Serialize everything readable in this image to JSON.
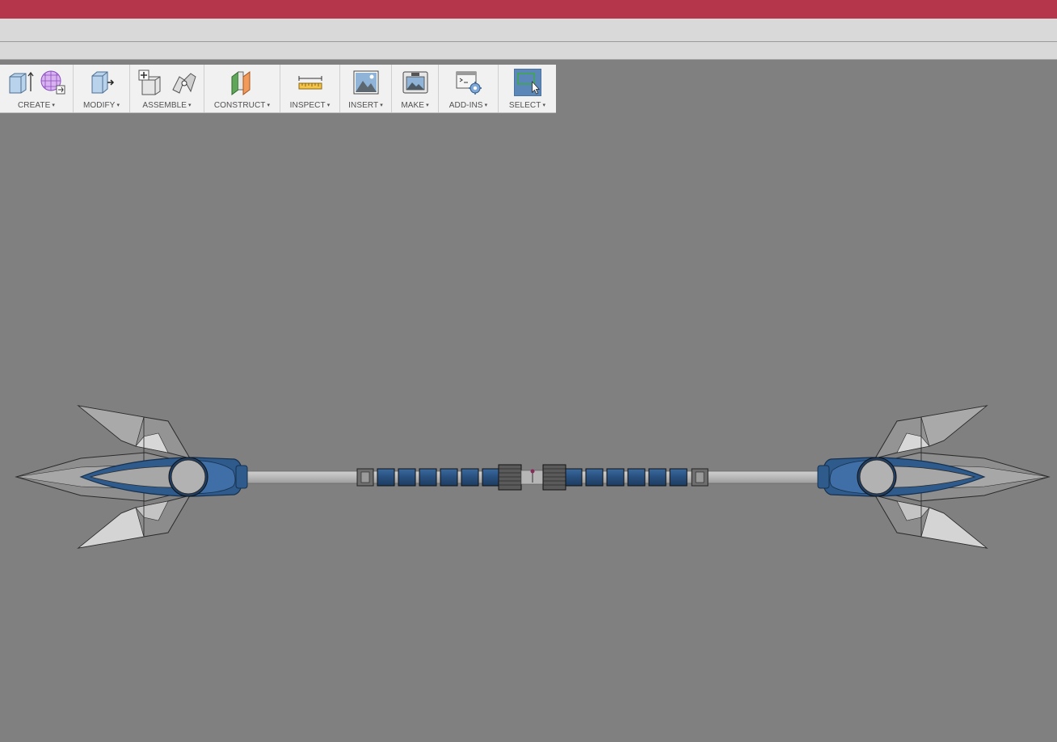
{
  "toolbar": {
    "groups": [
      {
        "label": "CREATE"
      },
      {
        "label": "MODIFY"
      },
      {
        "label": "ASSEMBLE"
      },
      {
        "label": "CONSTRUCT"
      },
      {
        "label": "INSPECT"
      },
      {
        "label": "INSERT"
      },
      {
        "label": "MAKE"
      },
      {
        "label": "ADD-INS"
      },
      {
        "label": "SELECT"
      }
    ],
    "dropdown_glyph": "▾"
  },
  "colors": {
    "title_bar": "#b5364a",
    "viewport_background": "#808080",
    "model_blue": "#2e5a8c",
    "model_grey": "#b4b4b4",
    "select_highlight": "#5b86b8"
  }
}
